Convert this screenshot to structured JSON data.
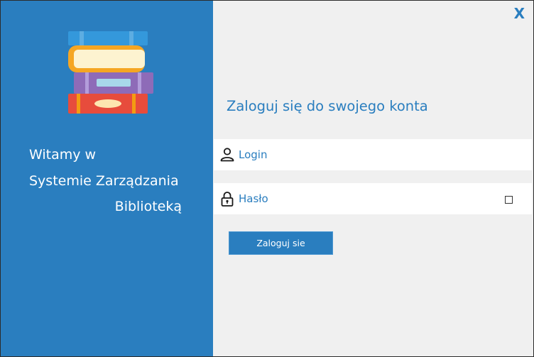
{
  "app": {
    "close_label": "X"
  },
  "welcome": {
    "line1": "Witamy w",
    "line2": "Systemie Zarządzania",
    "line3": "Biblioteką"
  },
  "login_form": {
    "heading": "Zaloguj się do swojego konta",
    "login_placeholder": "Login",
    "password_placeholder": "Hasło",
    "submit_label": "Zaloguj sie"
  },
  "icons": {
    "logo": "books-stack-icon",
    "login": "user-icon",
    "password": "padlock-icon"
  },
  "colors": {
    "accent": "#2a7ebf",
    "background": "#f0f0f0",
    "field_background": "#ffffff",
    "text_on_accent": "#ffffff"
  }
}
